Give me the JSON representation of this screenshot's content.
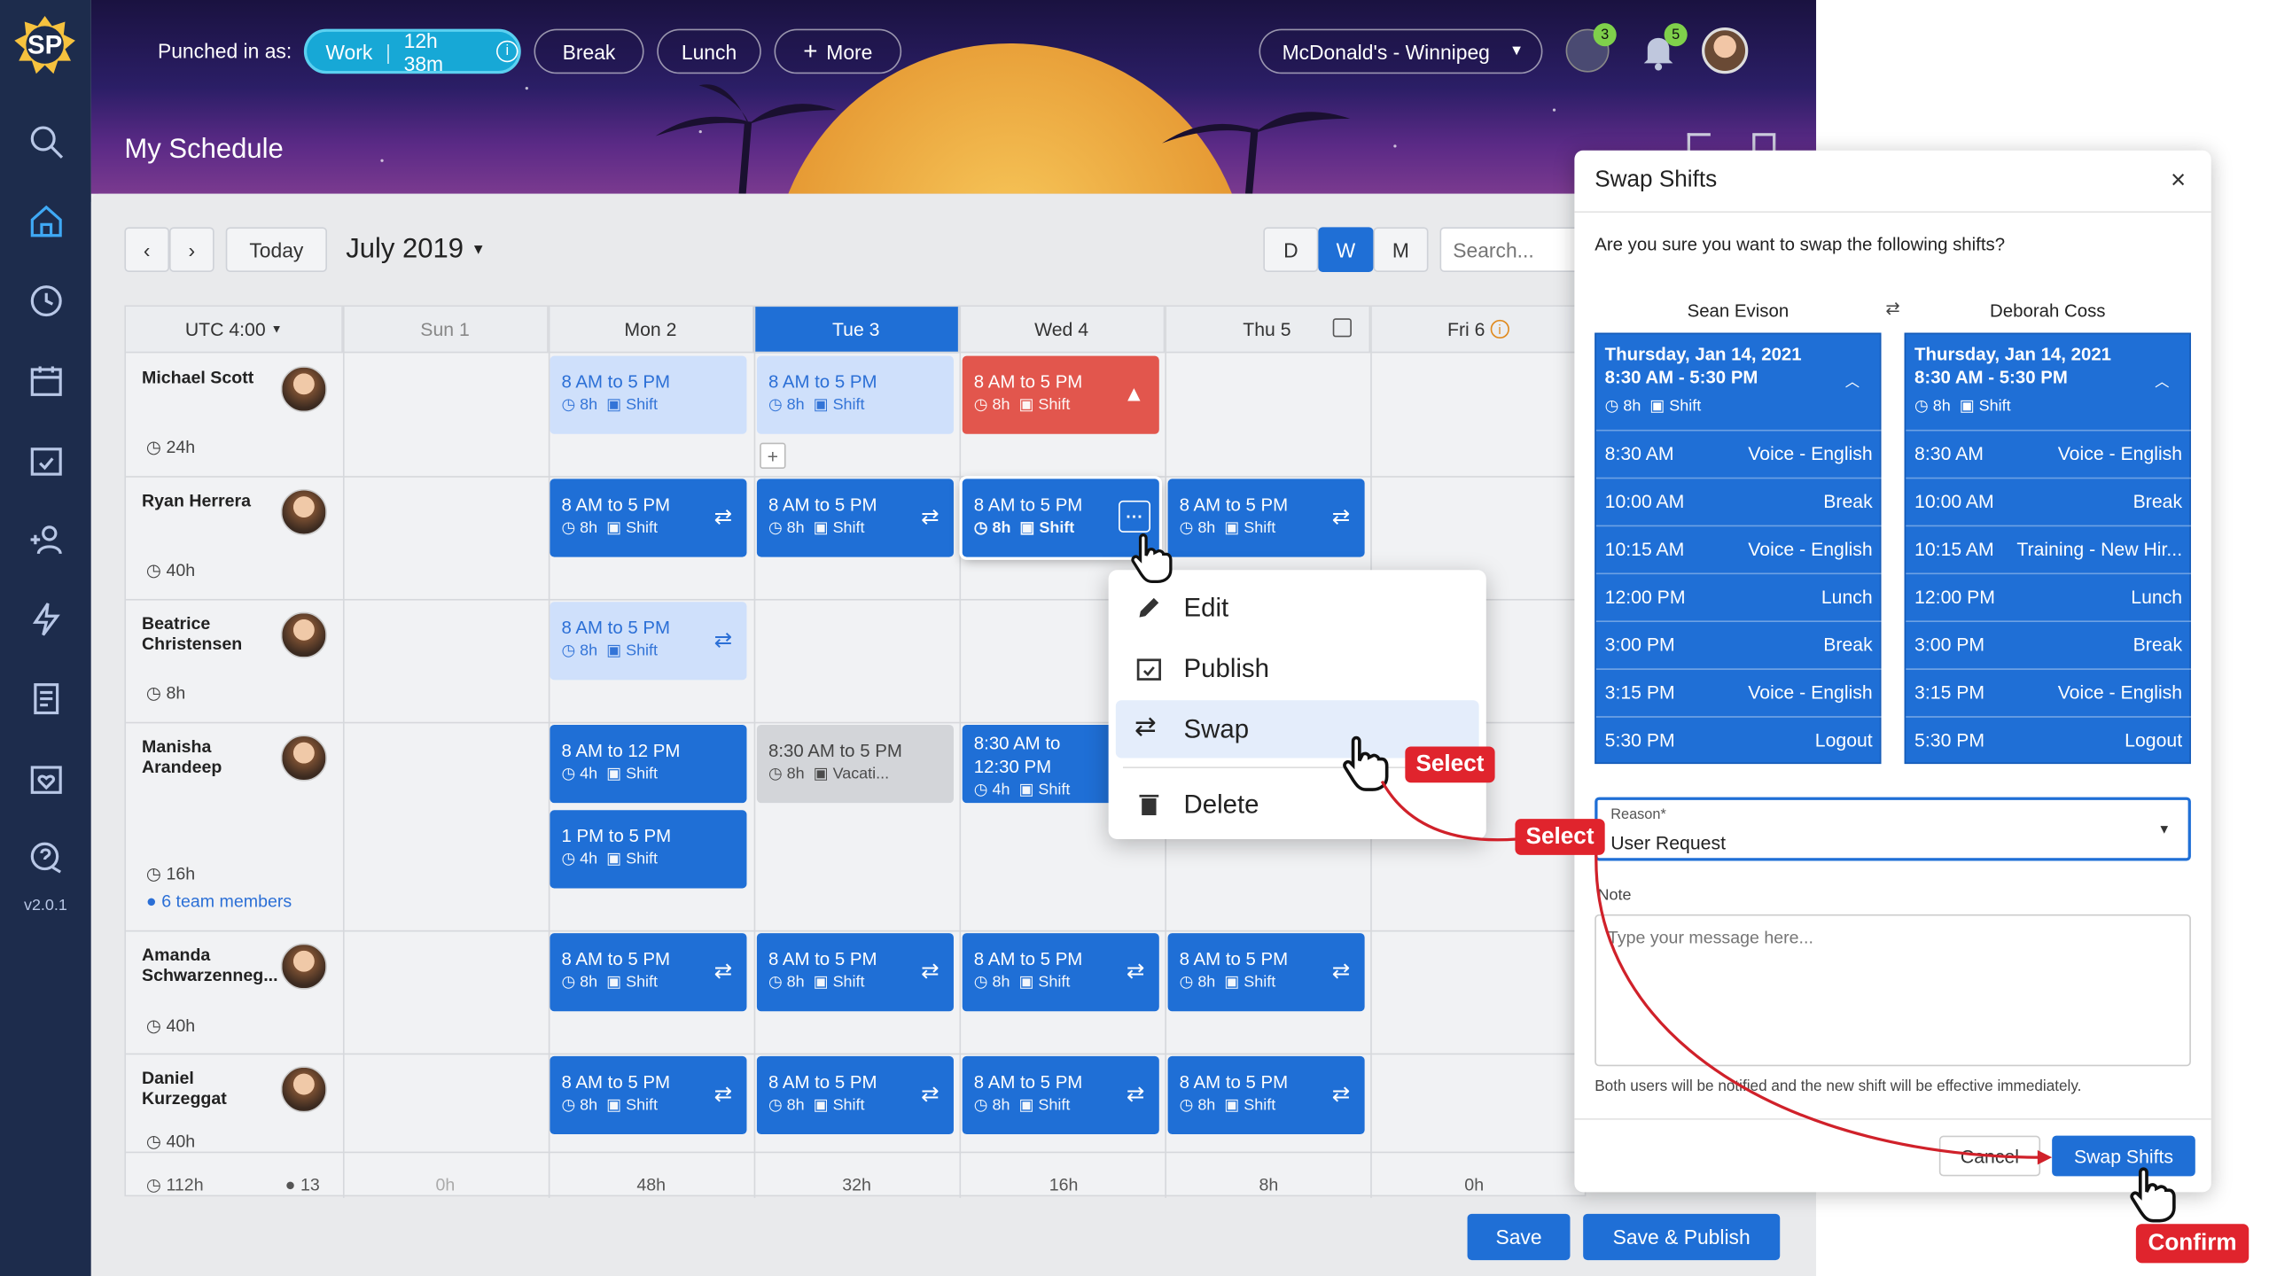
{
  "header": {
    "logo_text": "SP",
    "punched_label": "Punched in as:",
    "work_label": "Work",
    "work_time": "12h 38m",
    "buttons": {
      "break": "Break",
      "lunch": "Lunch",
      "more": "More"
    },
    "location": "McDonald's - Winnipeg",
    "chat_badge": "3",
    "bell_badge": "5",
    "page_title": "My Schedule"
  },
  "sidebar": {
    "version": "v2.0.1"
  },
  "toolbar": {
    "today": "Today",
    "month": "July 2019",
    "views": [
      "D",
      "W",
      "M"
    ],
    "active_view": "W",
    "search_placeholder": "Search..."
  },
  "grid": {
    "timezone": "UTC 4:00",
    "days": [
      "Sun 1",
      "Mon 2",
      "Tue 3",
      "Wed 4",
      "Thu 5",
      "Fri 6"
    ],
    "active_day": "Tue 3",
    "employees": [
      {
        "name": "Michael Scott",
        "hours": "24h"
      },
      {
        "name": "Ryan Herrera",
        "hours": "40h"
      },
      {
        "name": "Beatrice Christensen",
        "hours": "8h"
      },
      {
        "name": "Manisha Arandeep",
        "hours": "16h",
        "team": "6 team members"
      },
      {
        "name": "Amanda Schwarzenneg...",
        "hours": "40h"
      },
      {
        "name": "Daniel Kurzeggat",
        "hours": "40h"
      }
    ],
    "shift_label": "8 AM to 5 PM",
    "shift_hours": "8h",
    "shift_type": "Shift",
    "shift_12": "8 AM to 12 PM",
    "shift_12_hours": "4h",
    "shift_1pm": "1 PM to 5 PM",
    "shift_1pm_hours": "4h",
    "shift_830": "8:30 AM to 5 PM",
    "shift_vacation": "Vacati...",
    "shift_830_1230a": "8:30 AM to",
    "shift_830_1230b": "12:30 PM",
    "totals": {
      "hours": "112h",
      "count": "13",
      "days": [
        "0h",
        "48h",
        "32h",
        "16h",
        "8h",
        "0h"
      ]
    }
  },
  "context_menu": {
    "items": [
      "Edit",
      "Publish",
      "Swap",
      "Delete"
    ]
  },
  "modal": {
    "title": "Swap Shifts",
    "question": "Are you sure you want to swap the following shifts?",
    "left_name": "Sean Evison",
    "right_name": "Deborah Coss",
    "date": "Thursday, Jan 14, 2021",
    "time": "8:30 AM - 5:30 PM",
    "hours": "8h",
    "type": "Shift",
    "left_tasks": [
      {
        "time": "8:30 AM",
        "name": "Voice - English"
      },
      {
        "time": "10:00 AM",
        "name": "Break"
      },
      {
        "time": "10:15 AM",
        "name": "Voice - English"
      },
      {
        "time": "12:00 PM",
        "name": "Lunch"
      },
      {
        "time": "3:00 PM",
        "name": "Break"
      },
      {
        "time": "3:15 PM",
        "name": "Voice - English"
      },
      {
        "time": "5:30 PM",
        "name": "Logout"
      }
    ],
    "right_tasks": [
      {
        "time": "8:30 AM",
        "name": "Voice - English"
      },
      {
        "time": "10:00 AM",
        "name": "Break"
      },
      {
        "time": "10:15 AM",
        "name": "Training - New Hir..."
      },
      {
        "time": "12:00 PM",
        "name": "Lunch"
      },
      {
        "time": "3:00 PM",
        "name": "Break"
      },
      {
        "time": "3:15 PM",
        "name": "Voice - English"
      },
      {
        "time": "5:30 PM",
        "name": "Logout"
      }
    ],
    "reason_label": "Reason*",
    "reason_value": "User Request",
    "note_label": "Note",
    "note_placeholder": "Type your message here...",
    "footnote": "Both users will be notified and the new shift will be effective immediately.",
    "cancel": "Cancel",
    "confirm": "Swap Shifts"
  },
  "annotations": {
    "select1": "Select",
    "select2": "Select",
    "confirm": "Confirm"
  },
  "bottom": {
    "save": "Save",
    "save_publish": "Save & Publish"
  }
}
